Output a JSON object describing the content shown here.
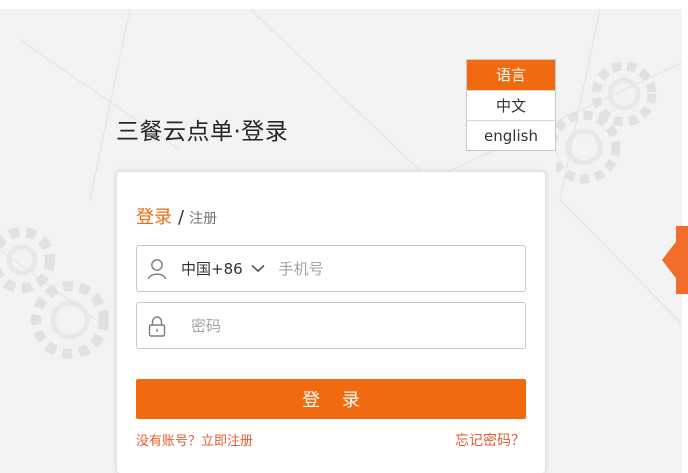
{
  "page": {
    "title": "三餐云点单·登录"
  },
  "language_menu": {
    "header": "语言",
    "options": [
      "中文",
      "english"
    ]
  },
  "login_card": {
    "tab_login": "登录",
    "tab_separator": "/",
    "tab_register": "注册",
    "country_code": "中国+86",
    "phone_placeholder": "手机号",
    "password_placeholder": "密码",
    "login_button": "登 录",
    "no_account_link": "没有账号？立即注册",
    "forgot_password_link": "忘记密码？"
  },
  "colors": {
    "accent": "#f26a0f",
    "link": "#e85c2f",
    "background": "#f3f3f3"
  },
  "icons": [
    "user-icon",
    "chevron-down-icon",
    "lock-icon",
    "gear-icon"
  ]
}
